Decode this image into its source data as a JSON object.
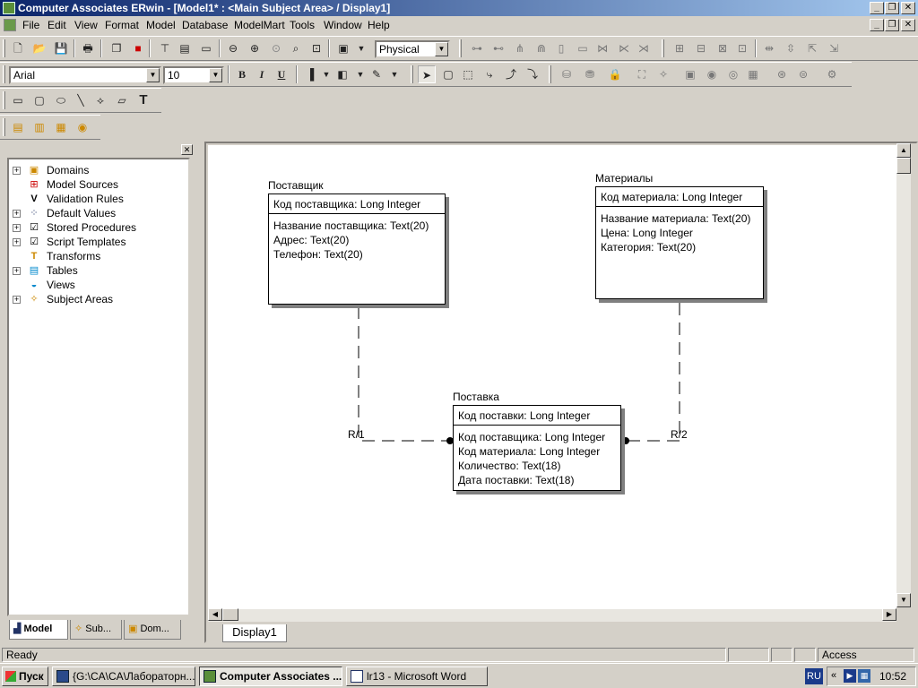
{
  "window": {
    "title": "Computer Associates ERwin - [Model1* : <Main Subject Area> / Display1]"
  },
  "menu": {
    "items": [
      "File",
      "Edit",
      "View",
      "Format",
      "Model",
      "Database",
      "ModelMart",
      "Tools",
      "Window",
      "Help"
    ]
  },
  "toolbar": {
    "model_view_select": "Physical",
    "font_family": "Arial",
    "font_size": "10",
    "bold_label": "B",
    "italic_label": "I",
    "underline_label": "U",
    "text_tool_label": "T"
  },
  "tree": {
    "items": [
      {
        "label": "Domains",
        "icon": "domains-icon",
        "expandable": true
      },
      {
        "label": "Model Sources",
        "icon": "model-sources-icon",
        "expandable": false
      },
      {
        "label": "Validation Rules",
        "icon": "validation-rules-icon",
        "expandable": false
      },
      {
        "label": "Default Values",
        "icon": "default-values-icon",
        "expandable": true
      },
      {
        "label": "Stored Procedures",
        "icon": "stored-procedures-icon",
        "expandable": true
      },
      {
        "label": "Script Templates",
        "icon": "script-templates-icon",
        "expandable": true
      },
      {
        "label": "Transforms",
        "icon": "transforms-icon",
        "expandable": false
      },
      {
        "label": "Tables",
        "icon": "tables-icon",
        "expandable": true
      },
      {
        "label": "Views",
        "icon": "views-icon",
        "expandable": false
      },
      {
        "label": "Subject Areas",
        "icon": "subject-areas-icon",
        "expandable": true
      }
    ]
  },
  "panel_tabs": [
    "Model",
    "Sub...",
    "Dom..."
  ],
  "diagram": {
    "entities": [
      {
        "name": "Поставщик",
        "pk": "Код поставщика: Long Integer",
        "attributes": [
          "Название поставщика: Text(20)",
          "Адрес: Text(20)",
          "Телефон: Text(20)"
        ]
      },
      {
        "name": "Материалы",
        "pk": "Код материала: Long Integer",
        "attributes": [
          "Название материала: Text(20)",
          "Цена: Long Integer",
          "Категория: Text(20)"
        ]
      },
      {
        "name": "Поставка",
        "pk": "Код поставки: Long Integer",
        "attributes": [
          "Код поставщика: Long Integer",
          "Код материала: Long Integer",
          "Количество: Text(18)",
          "Дата поставки: Text(18)"
        ]
      }
    ],
    "relationships": [
      "R/1",
      "R/2"
    ]
  },
  "canvas_tab": "Display1",
  "status": {
    "left": "Ready",
    "right": "Access"
  },
  "taskbar": {
    "start": "Пуск",
    "tasks": [
      "{G:\\CA\\CA\\Лабораторн...",
      "Computer Associates ...",
      "lr13 - Microsoft Word"
    ],
    "lang": "RU",
    "time": "10:52"
  }
}
